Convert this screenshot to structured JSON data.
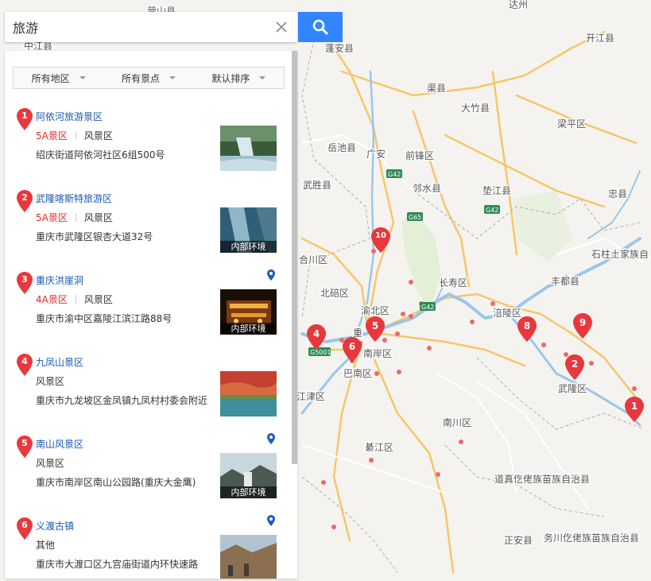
{
  "search": {
    "query": "旅游"
  },
  "filters": [
    "所有地区",
    "所有景点",
    "默认排序"
  ],
  "results": [
    {
      "num": "1",
      "title": "阿依河旅游景区",
      "grade": "5A景区",
      "category": "风景区",
      "address": "绍庆街道阿依河社区6组500号",
      "thumb_tag": ""
    },
    {
      "num": "2",
      "title": "武隆喀斯特旅游区",
      "grade": "5A景区",
      "category": "风景区",
      "address": "重庆市武隆区银杏大道32号",
      "thumb_tag": "内部环境"
    },
    {
      "num": "3",
      "title": "重庆洪崖洞",
      "grade": "4A景区",
      "category": "风景区",
      "address": "重庆市渝中区嘉陵江滨江路88号",
      "thumb_tag": "内部环境"
    },
    {
      "num": "4",
      "title": "九凤山景区",
      "grade": "",
      "category": "风景区",
      "address": "重庆市九龙坡区金凤镇九凤村村委会附近",
      "thumb_tag": ""
    },
    {
      "num": "5",
      "title": "南山风景区",
      "grade": "",
      "category": "风景区",
      "address": "重庆市南岸区南山公园路(重庆大金鹰)",
      "thumb_tag": "内部环境"
    },
    {
      "num": "6",
      "title": "义渡古镇",
      "grade": "",
      "category": "其他",
      "address": "重庆市大渡口区九宫庙街道内环快速路",
      "thumb_tag": ""
    }
  ],
  "map": {
    "places": [
      "达州",
      "开江县",
      "蓬安县",
      "渠县",
      "大竹县",
      "梁平区",
      "岳池县",
      "广安",
      "前锋区",
      "邻水县",
      "垫江县",
      "忠县",
      "武胜县",
      "石柱土家族自",
      "合川区",
      "长寿区",
      "丰都县",
      "北碚区",
      "渝北区",
      "涪陵区",
      "重",
      "南岸区",
      "巴南区",
      "武隆区",
      "江津区",
      "南川区",
      "綦江区",
      "道真仡佬族苗族自治县",
      "正安县",
      "务川仡佬族苗族自治县",
      "中江县",
      "营山县"
    ],
    "highways": [
      "G42",
      "G65",
      "G42",
      "G42",
      "G5001"
    ],
    "markers": [
      "1",
      "2",
      "4",
      "5",
      "6",
      "8",
      "9",
      "10"
    ]
  },
  "colors": {
    "accent": "#3385ff",
    "marker": "#e8383d",
    "link": "#1a57b2",
    "grade": "#e02b2b"
  }
}
